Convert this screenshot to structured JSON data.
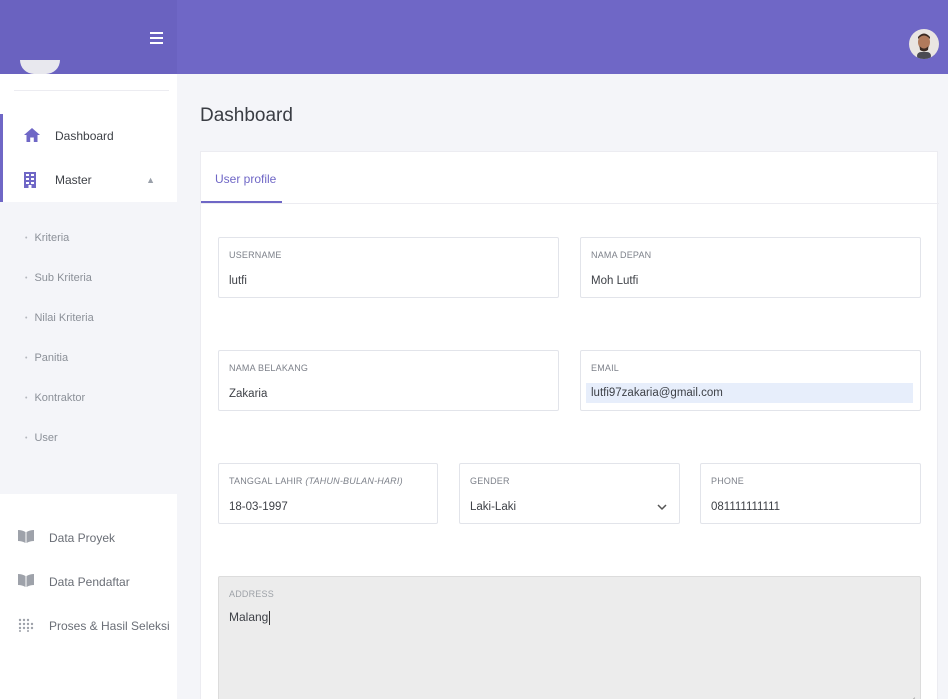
{
  "header": {
    "menu_icon": "hamburger-icon",
    "avatar_icon": "user-avatar"
  },
  "sidebar": {
    "dashboard": {
      "label": "Dashboard",
      "icon": "home-icon"
    },
    "master": {
      "label": "Master",
      "icon": "building-icon",
      "expanded": true
    },
    "master_items": [
      "Kriteria",
      "Sub Kriteria",
      "Nilai Kriteria",
      "Panitia",
      "Kontraktor",
      "User"
    ],
    "data_proyek": {
      "label": "Data Proyek",
      "icon": "book-icon"
    },
    "data_pendaftar": {
      "label": "Data Pendaftar",
      "icon": "book-icon"
    },
    "proses": {
      "label": "Proses & Hasil Seleksi",
      "icon": "grid-dots-icon"
    }
  },
  "page": {
    "title": "Dashboard"
  },
  "tabs": {
    "user_profile": "User profile"
  },
  "form": {
    "username": {
      "label": "USERNAME",
      "value": "lutfi"
    },
    "nama_depan": {
      "label": "NAMA DEPAN",
      "value": "Moh Lutfi"
    },
    "nama_belakang": {
      "label": "NAMA BELAKANG",
      "value": "Zakaria"
    },
    "email": {
      "label": "EMAIL",
      "value": "lutfi97zakaria@gmail.com"
    },
    "tanggal_lahir": {
      "label": "TANGGAL LAHIR",
      "label_hint": "(TAHUN-BULAN-HARI)",
      "value": "18-03-1997"
    },
    "gender": {
      "label": "GENDER",
      "value": "Laki-Laki"
    },
    "phone": {
      "label": "PHONE",
      "value": "081111111111"
    },
    "address": {
      "label": "ADDRESS",
      "value": "Malang"
    }
  },
  "colors": {
    "accent": "#6f67c6",
    "sidebar_bg": "#ffffff",
    "page_bg": "#f4f5f9"
  }
}
